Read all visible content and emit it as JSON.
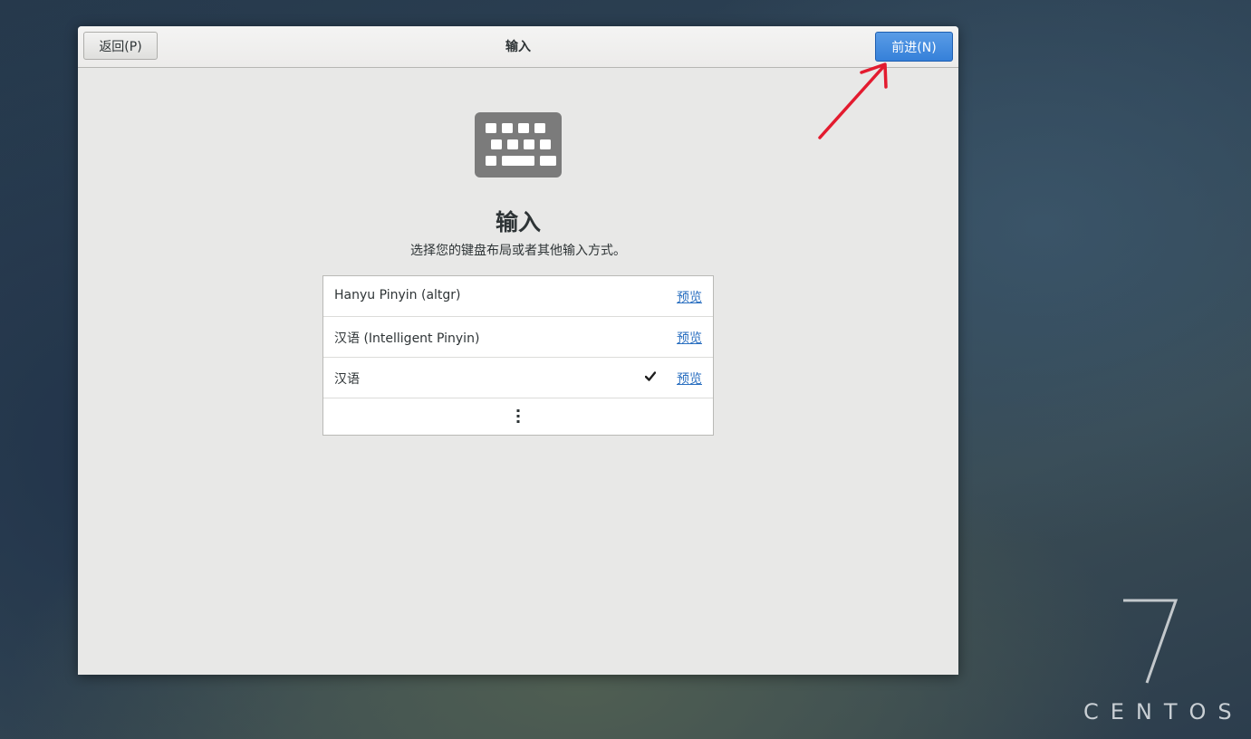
{
  "header": {
    "back_label": "返回(P)",
    "title": "输入",
    "next_label": "前进(N)"
  },
  "page": {
    "title": "输入",
    "subtitle": "选择您的键盘布局或者其他输入方式。"
  },
  "input_sources": [
    {
      "label": "Hanyu Pinyin (altgr)",
      "selected": false,
      "preview_label": "预览"
    },
    {
      "label": "汉语 (Intelligent Pinyin)",
      "selected": false,
      "preview_label": "预览"
    },
    {
      "label": "汉语",
      "selected": true,
      "preview_label": "预览"
    }
  ],
  "icons": {
    "hero": "keyboard-icon",
    "selected": "checkmark-icon",
    "more": "more-vertical-icon",
    "annotation": "red-arrow-icon"
  },
  "colors": {
    "accent": "#3580d9",
    "link": "#2a6fc0",
    "annotation": "#e31b2f"
  },
  "branding": {
    "version": "7",
    "os_name": "CENTOS"
  }
}
